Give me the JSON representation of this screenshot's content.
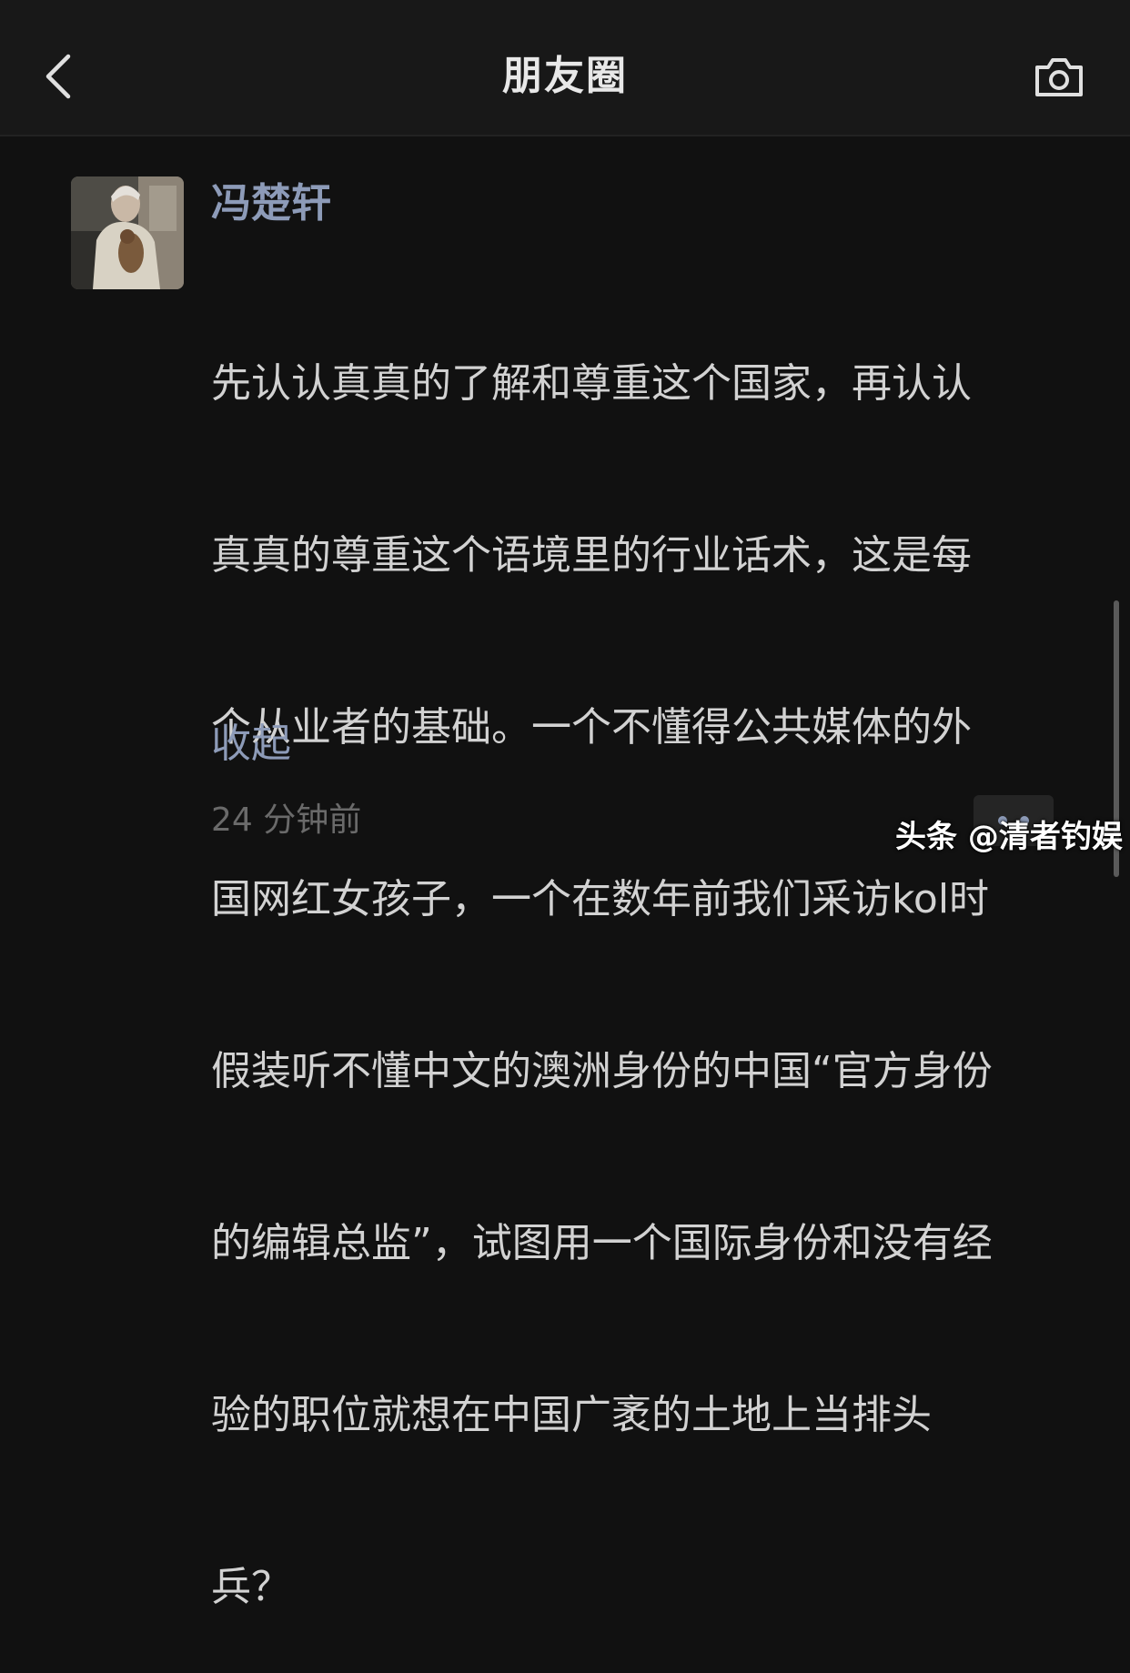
{
  "header": {
    "title": "朋友圈",
    "back_icon": "chevron-left-icon",
    "camera_icon": "camera-icon"
  },
  "post": {
    "author": "冯楚轩",
    "lines": [
      "先认认真真的了解和尊重这个国家，再认认",
      "真真的尊重这个语境里的行业话术，这是每",
      "个从业者的基础。一个不懂得公共媒体的外",
      "国网红女孩子，一个在数年前我们采访kol时",
      "假装听不懂中文的澳洲身份的中国“官方身份",
      "的编辑总监”，试图用一个国际身份和没有经",
      "验的职位就想在中国广袤的土地上当排头",
      "兵？"
    ],
    "collapse_label": "收起",
    "time": "24 分钟前"
  },
  "watermark": "头条 @清者钓娱",
  "colors": {
    "background": "#111111",
    "navbar": "#181818",
    "link": "#8d9bb8",
    "text": "#d2d2d2",
    "muted": "#6a6a6a"
  }
}
